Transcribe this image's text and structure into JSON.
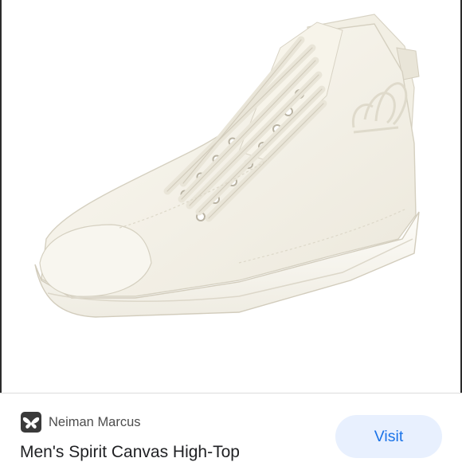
{
  "product_image": {
    "icon": "sneaker-product-image",
    "colors": {
      "canvas": "#f5f2e8",
      "sole": "#fbfaf5",
      "background": "#ffffff"
    }
  },
  "result": {
    "source_icon": "butterfly-icon",
    "source_name": "Neiman Marcus",
    "title": "Men's Spirit Canvas High-Top",
    "visit_label": "Visit"
  },
  "colors": {
    "visit_bg": "#e8f0fe",
    "visit_text": "#1a73e8",
    "title_text": "#202124",
    "source_text": "#4d4d4d"
  }
}
